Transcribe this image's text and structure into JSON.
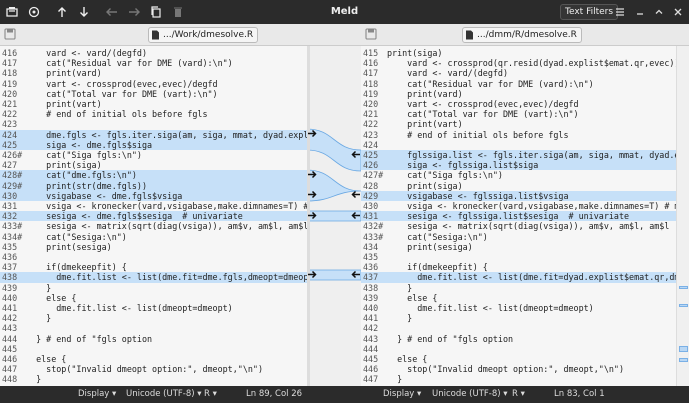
{
  "app": {
    "title": "Meld"
  },
  "toolbar": {
    "text_filters_label": "Text Filters"
  },
  "left_file": {
    "name": ".../Work/dmesolve.R"
  },
  "right_file": {
    "name": ".../dmm/R/dmesolve.R"
  },
  "left_lines": [
    {
      "n": "416",
      "t": "    vard <- vard/(degfd)",
      "s": ""
    },
    {
      "n": "417",
      "t": "    cat(\"Residual var for DME (vard):\\n\")",
      "s": ""
    },
    {
      "n": "418",
      "t": "    print(vard)",
      "s": ""
    },
    {
      "n": "419",
      "t": "    vart <- crossprod(evec,evec)/degfd",
      "s": ""
    },
    {
      "n": "420",
      "t": "    cat(\"Total var for DME (vart):\\n\")",
      "s": ""
    },
    {
      "n": "421",
      "t": "    print(vart)",
      "s": ""
    },
    {
      "n": "422",
      "t": "    # end of initial ols before fgls",
      "s": ""
    },
    {
      "n": "423",
      "t": "",
      "s": ""
    },
    {
      "n": "424",
      "t": "    dme.fgls <- fgls.iter.siga(am, siga, mmat, dyad.explis",
      "s": "chg"
    },
    {
      "n": "425",
      "t": "    siga <- dme.fgls$siga",
      "s": "chg"
    },
    {
      "n": "426#",
      "t": "    cat(\"Siga fgls:\\n\")",
      "s": ""
    },
    {
      "n": "427",
      "t": "    print(siga)",
      "s": ""
    },
    {
      "n": "428#",
      "t": "    cat(\"dme.fgls:\\n\")",
      "s": "chg"
    },
    {
      "n": "429#",
      "t": "    print(str(dme.fgls))",
      "s": "chg"
    },
    {
      "n": "430",
      "t": "    vsigabase <- dme.fgls$vsiga",
      "s": "chg"
    },
    {
      "n": "431",
      "t": "    vsiga <- kronecker(vard,vsigabase,make.dimnames=T) # m",
      "s": ""
    },
    {
      "n": "432",
      "t": "    sesiga <- dme.fgls$sesiga  # univariate",
      "s": "chg"
    },
    {
      "n": "433#",
      "t": "    sesiga <- matrix(sqrt(diag(vsiga)), am$v, am$l, am$l",
      "s": ""
    },
    {
      "n": "434#",
      "t": "    cat(\"Sesiga:\\n\")",
      "s": ""
    },
    {
      "n": "435",
      "t": "    print(sesiga)",
      "s": ""
    },
    {
      "n": "436",
      "t": "",
      "s": ""
    },
    {
      "n": "437",
      "t": "    if(dmekeepfit) {",
      "s": ""
    },
    {
      "n": "438",
      "t": "      dme.fit.list <- list(dme.fit=dme.fgls,dmeopt=dmeopt)",
      "s": "chg"
    },
    {
      "n": "439",
      "t": "    }",
      "s": ""
    },
    {
      "n": "440",
      "t": "    else {",
      "s": ""
    },
    {
      "n": "441",
      "t": "      dme.fit.list <- list(dmeopt=dmeopt)",
      "s": ""
    },
    {
      "n": "442",
      "t": "    }",
      "s": ""
    },
    {
      "n": "443",
      "t": "",
      "s": ""
    },
    {
      "n": "444",
      "t": "  } # end of \"fgls option",
      "s": ""
    },
    {
      "n": "445",
      "t": "",
      "s": ""
    },
    {
      "n": "446",
      "t": "  else {",
      "s": ""
    },
    {
      "n": "447",
      "t": "    stop(\"Invalid dmeopt option:\", dmeopt,\"\\n\")",
      "s": ""
    },
    {
      "n": "448",
      "t": "  }",
      "s": ""
    }
  ],
  "right_lines": [
    {
      "n": "415",
      "t": "print(siga)",
      "s": ""
    },
    {
      "n": "416",
      "t": "    vard <- crossprod(qr.resid(dyad.explist$emat.qr,evec))",
      "s": ""
    },
    {
      "n": "417",
      "t": "    vard <- vard/(degfd)",
      "s": ""
    },
    {
      "n": "418",
      "t": "    cat(\"Residual var for DME (vard):\\n\")",
      "s": ""
    },
    {
      "n": "419",
      "t": "    print(vard)",
      "s": ""
    },
    {
      "n": "420",
      "t": "    vart <- crossprod(evec,evec)/degfd",
      "s": ""
    },
    {
      "n": "421",
      "t": "    cat(\"Total var for DME (vart):\\n\")",
      "s": ""
    },
    {
      "n": "422",
      "t": "    print(vart)",
      "s": ""
    },
    {
      "n": "423",
      "t": "    # end of initial ols before fgls",
      "s": ""
    },
    {
      "n": "424",
      "t": "",
      "s": ""
    },
    {
      "n": "425",
      "t": "    fglssiga.list <- fgls.iter.siga(am, siga, mmat, dyad.e",
      "s": "chg"
    },
    {
      "n": "426",
      "t": "    siga <- fglssiga.list$siga",
      "s": "chg"
    },
    {
      "n": "427#",
      "t": "    cat(\"Siga fgls:\\n\")",
      "s": ""
    },
    {
      "n": "428",
      "t": "    print(siga)",
      "s": ""
    },
    {
      "n": "429",
      "t": "    vsigabase <- fglssiga.list$vsiga",
      "s": "chg"
    },
    {
      "n": "430",
      "t": "    vsiga <- kronecker(vard,vsigabase,make.dimnames=T) # m",
      "s": ""
    },
    {
      "n": "431",
      "t": "    sesiga <- fglssiga.list$sesiga  # univariate",
      "s": "chg"
    },
    {
      "n": "432#",
      "t": "    sesiga <- matrix(sqrt(diag(vsiga)), am$v, am$l, am$l",
      "s": ""
    },
    {
      "n": "433#",
      "t": "    cat(\"Sesiga:\\n\")",
      "s": ""
    },
    {
      "n": "434",
      "t": "    print(sesiga)",
      "s": ""
    },
    {
      "n": "435",
      "t": "",
      "s": ""
    },
    {
      "n": "436",
      "t": "    if(dmekeepfit) {",
      "s": ""
    },
    {
      "n": "437",
      "t": "      dme.fit.list <- list(dme.fit=dyad.explist$emat.qr,dm",
      "s": "chg"
    },
    {
      "n": "438",
      "t": "    }",
      "s": ""
    },
    {
      "n": "439",
      "t": "    else {",
      "s": ""
    },
    {
      "n": "440",
      "t": "      dme.fit.list <- list(dmeopt=dmeopt)",
      "s": ""
    },
    {
      "n": "441",
      "t": "    }",
      "s": ""
    },
    {
      "n": "442",
      "t": "",
      "s": ""
    },
    {
      "n": "443",
      "t": "  } # end of \"fgls option",
      "s": ""
    },
    {
      "n": "444",
      "t": "",
      "s": ""
    },
    {
      "n": "445",
      "t": "  else {",
      "s": ""
    },
    {
      "n": "446",
      "t": "    stop(\"Invalid dmeopt option:\", dmeopt,\"\\n\")",
      "s": ""
    },
    {
      "n": "447",
      "t": "  }",
      "s": ""
    }
  ],
  "status": {
    "left_display": "Display",
    "left_encoding": "Unicode (UTF-8)",
    "left_lang": "R",
    "left_pos": "Ln 89, Col 26",
    "right_display": "Display",
    "right_encoding": "Unicode (UTF-8)",
    "right_lang": "R",
    "right_pos": "Ln 83, Col 1"
  },
  "colors": {
    "change_bg": "#c6e0f8",
    "change_hl": "#8fc1f2",
    "change_border": "#6aa8e3"
  }
}
